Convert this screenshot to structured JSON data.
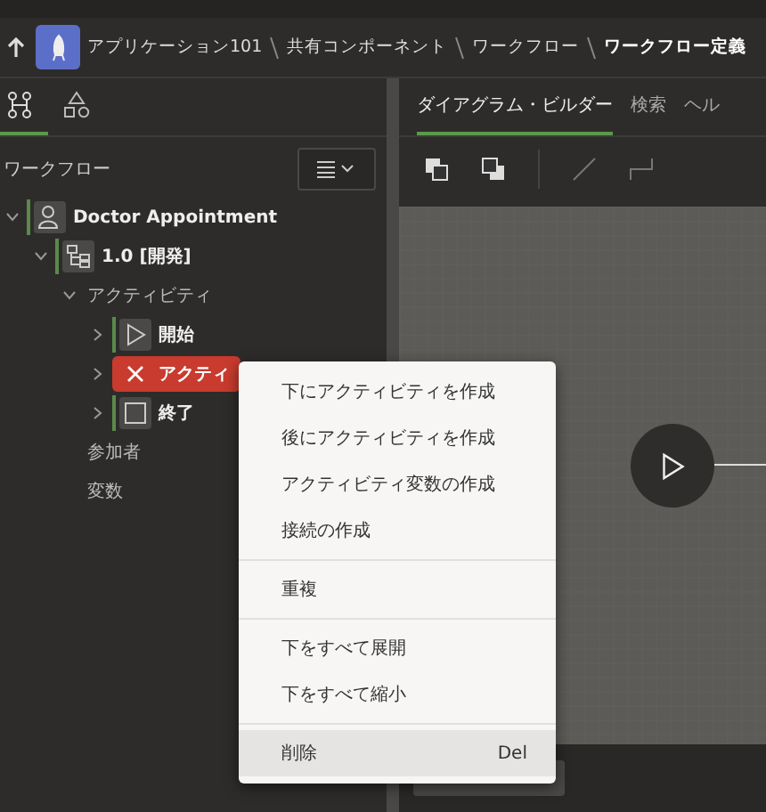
{
  "header": {
    "breadcrumb": [
      {
        "label": "アプリケーション101",
        "current": false
      },
      {
        "label": "共有コンポーネント",
        "current": false
      },
      {
        "label": "ワークフロー",
        "current": false
      },
      {
        "label": "ワークフロー定義",
        "current": true
      }
    ]
  },
  "left_tabs": [
    {
      "kind": "tree",
      "selected": true
    },
    {
      "kind": "shapes",
      "selected": false
    }
  ],
  "tree": {
    "title": "ワークフロー",
    "items": [
      {
        "label": "Doctor Appointment",
        "kind": "workflow",
        "expanded": true,
        "error": false,
        "children": [
          {
            "label": "1.0 [開発]",
            "kind": "version",
            "expanded": true,
            "error": false,
            "children": [
              {
                "label": "アクティビティ",
                "expanded": true,
                "error": false,
                "children": [
                  {
                    "label": "開始",
                    "kind": "start",
                    "expanded": false,
                    "error": false
                  },
                  {
                    "label": "アクティ",
                    "expanded": false,
                    "error": true
                  },
                  {
                    "label": "終了",
                    "kind": "end",
                    "expanded": false,
                    "error": false
                  }
                ]
              },
              {
                "label": "参加者",
                "error": false
              },
              {
                "label": "変数",
                "error": false
              }
            ]
          }
        ]
      }
    ]
  },
  "right_tabs": [
    {
      "label": "ダイアグラム・ビルダー",
      "selected": true
    },
    {
      "label": "検索",
      "selected": false
    },
    {
      "label": "ヘル",
      "selected": false
    }
  ],
  "context_menu": {
    "sections": [
      {
        "items": [
          {
            "label": "下にアクティビティを作成",
            "highlighted": false
          },
          {
            "label": "後にアクティビティを作成",
            "highlighted": false
          },
          {
            "label": "アクティビティ変数の作成",
            "highlighted": false
          },
          {
            "label": "接続の作成",
            "highlighted": false
          }
        ]
      },
      {
        "items": [
          {
            "label": "重複",
            "highlighted": false
          }
        ]
      },
      {
        "items": [
          {
            "label": "下をすべて展開",
            "highlighted": false
          },
          {
            "label": "下をすべて縮小",
            "highlighted": false
          }
        ]
      },
      {
        "items": [
          {
            "label": "削除",
            "shortcut": "Del",
            "highlighted": true
          }
        ]
      }
    ]
  }
}
